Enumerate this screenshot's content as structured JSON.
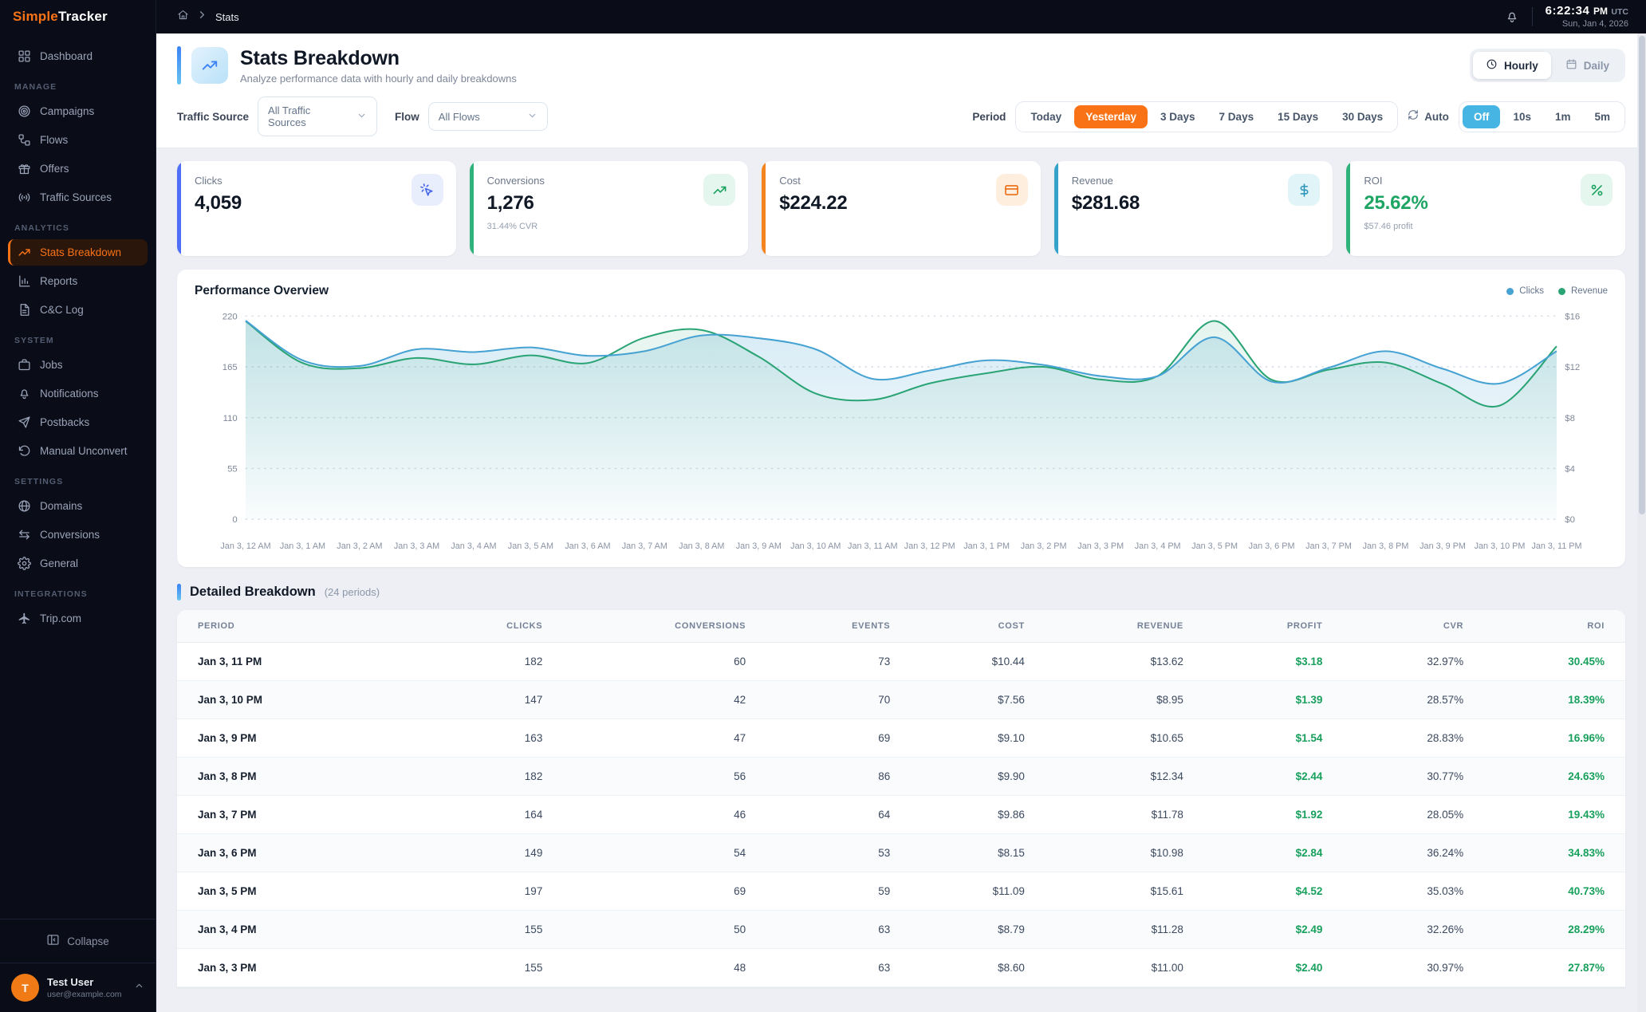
{
  "brand": {
    "name_primary": "Simple",
    "name_secondary": "Tracker"
  },
  "topbar": {
    "breadcrumb_current": "Stats",
    "clock_time": "6:22:34",
    "clock_meridiem": "PM",
    "clock_tz": "UTC",
    "clock_date": "Sun, Jan 4, 2026"
  },
  "sidebar": {
    "sections": [
      {
        "label": "",
        "items": [
          {
            "label": "Dashboard",
            "icon": "grid-icon",
            "active": false
          }
        ]
      },
      {
        "label": "MANAGE",
        "items": [
          {
            "label": "Campaigns",
            "icon": "target-icon",
            "active": false
          },
          {
            "label": "Flows",
            "icon": "flow-icon",
            "active": false
          },
          {
            "label": "Offers",
            "icon": "gift-icon",
            "active": false
          },
          {
            "label": "Traffic Sources",
            "icon": "broadcast-icon",
            "active": false
          }
        ]
      },
      {
        "label": "ANALYTICS",
        "items": [
          {
            "label": "Stats Breakdown",
            "icon": "trend-up-icon",
            "active": true
          },
          {
            "label": "Reports",
            "icon": "bar-chart-icon",
            "active": false
          },
          {
            "label": "C&C Log",
            "icon": "document-icon",
            "active": false
          }
        ]
      },
      {
        "label": "SYSTEM",
        "items": [
          {
            "label": "Jobs",
            "icon": "briefcase-icon",
            "active": false
          },
          {
            "label": "Notifications",
            "icon": "bell-icon",
            "active": false
          },
          {
            "label": "Postbacks",
            "icon": "send-icon",
            "active": false
          },
          {
            "label": "Manual Unconvert",
            "icon": "undo-icon",
            "active": false
          }
        ]
      },
      {
        "label": "SETTINGS",
        "items": [
          {
            "label": "Domains",
            "icon": "globe-icon",
            "active": false
          },
          {
            "label": "Conversions",
            "icon": "swap-icon",
            "active": false
          },
          {
            "label": "General",
            "icon": "gear-icon",
            "active": false
          }
        ]
      },
      {
        "label": "INTEGRATIONS",
        "items": [
          {
            "label": "Trip.com",
            "icon": "plane-icon",
            "active": false
          }
        ]
      }
    ],
    "collapse_label": "Collapse",
    "user": {
      "initial": "T",
      "name": "Test User",
      "email": "user@example.com"
    }
  },
  "page": {
    "title": "Stats Breakdown",
    "subtitle": "Analyze performance data with hourly and daily breakdowns",
    "view_toggle": [
      {
        "label": "Hourly",
        "icon": "clock-icon",
        "active": true
      },
      {
        "label": "Daily",
        "icon": "calendar-icon",
        "active": false
      }
    ]
  },
  "filters": {
    "traffic_source_label": "Traffic Source",
    "traffic_source_value": "All Traffic Sources",
    "flow_label": "Flow",
    "flow_value": "All Flows",
    "period_label": "Period",
    "period_options": [
      {
        "label": "Today",
        "active": false
      },
      {
        "label": "Yesterday",
        "active": true
      },
      {
        "label": "3 Days",
        "active": false
      },
      {
        "label": "7 Days",
        "active": false
      },
      {
        "label": "15 Days",
        "active": false
      },
      {
        "label": "30 Days",
        "active": false
      }
    ],
    "auto_label": "Auto",
    "refresh_options": [
      {
        "label": "Off",
        "active": true
      },
      {
        "label": "10s",
        "active": false
      },
      {
        "label": "1m",
        "active": false
      },
      {
        "label": "5m",
        "active": false
      }
    ],
    "active_period_color": "#f97316",
    "active_refresh_color": "#47b5e3"
  },
  "stat_cards": [
    {
      "label": "Clicks",
      "value": "4,059",
      "sub": "",
      "icon": "cursor-click-icon",
      "accent": "#4f6ef7",
      "icon_color": "#4263eb",
      "icon_bg": "#e9eefc",
      "value_color": ""
    },
    {
      "label": "Conversions",
      "value": "1,276",
      "sub": "31.44% CVR",
      "icon": "trend-up-icon",
      "accent": "#2fb27c",
      "icon_color": "#18a05c",
      "icon_bg": "#e4f6ee",
      "value_color": ""
    },
    {
      "label": "Cost",
      "value": "$224.22",
      "sub": "",
      "icon": "credit-card-icon",
      "accent": "#f4841f",
      "icon_color": "#ec6c13",
      "icon_bg": "#fdeedd",
      "value_color": ""
    },
    {
      "label": "Revenue",
      "value": "$281.68",
      "sub": "",
      "icon": "dollar-icon",
      "accent": "#35a3c9",
      "icon_color": "#2f96ba",
      "icon_bg": "#e1f5f9",
      "value_color": ""
    },
    {
      "label": "ROI",
      "value": "25.62%",
      "sub": "$57.46 profit",
      "icon": "percent-icon",
      "accent": "#2fb27c",
      "icon_color": "#18a05c",
      "icon_bg": "#e4f6ee",
      "value_color": "#1ea563"
    }
  ],
  "chart": {
    "title": "Performance Overview"
  },
  "chart_data": {
    "type": "line",
    "x": [
      "Jan 3, 12 AM",
      "Jan 3, 1 AM",
      "Jan 3, 2 AM",
      "Jan 3, 3 AM",
      "Jan 3, 4 AM",
      "Jan 3, 5 AM",
      "Jan 3, 6 AM",
      "Jan 3, 7 AM",
      "Jan 3, 8 AM",
      "Jan 3, 9 AM",
      "Jan 3, 10 AM",
      "Jan 3, 11 AM",
      "Jan 3, 12 PM",
      "Jan 3, 1 PM",
      "Jan 3, 2 PM",
      "Jan 3, 3 PM",
      "Jan 3, 4 PM",
      "Jan 3, 5 PM",
      "Jan 3, 6 PM",
      "Jan 3, 7 PM",
      "Jan 3, 8 PM",
      "Jan 3, 9 PM",
      "Jan 3, 10 PM",
      "Jan 3, 11 PM"
    ],
    "series": [
      {
        "name": "Clicks",
        "axis": "left",
        "color": "#46a2d2",
        "values": [
          215,
          172,
          166,
          184,
          181,
          186,
          177,
          182,
          199,
          196,
          184,
          152,
          161,
          172,
          167,
          155,
          155,
          197,
          149,
          164,
          182,
          163,
          147,
          182
        ]
      },
      {
        "name": "Revenue",
        "axis": "right",
        "color": "#2aa474",
        "values": [
          15.6,
          12.3,
          11.9,
          12.7,
          12.2,
          12.9,
          12.3,
          14.3,
          14.9,
          12.8,
          9.9,
          9.4,
          10.7,
          11.5,
          12.0,
          11.0,
          11.28,
          15.61,
          10.98,
          11.78,
          12.34,
          10.65,
          8.95,
          13.62
        ]
      }
    ],
    "left_axis": {
      "ticks": [
        220,
        165,
        110,
        55,
        0
      ],
      "max": 220
    },
    "right_axis": {
      "ticks": [
        "$16",
        "$12",
        "$8",
        "$4",
        "$0"
      ],
      "max": 16
    },
    "grid": "dotted-horizontal",
    "legend_position": "top-right"
  },
  "table": {
    "title": "Detailed Breakdown",
    "subtitle": "(24 periods)",
    "columns": [
      "PERIOD",
      "CLICKS",
      "CONVERSIONS",
      "EVENTS",
      "COST",
      "REVENUE",
      "PROFIT",
      "CVR",
      "ROI"
    ],
    "green_columns": [
      6,
      8
    ],
    "rows": [
      [
        "Jan 3, 11 PM",
        "182",
        "60",
        "73",
        "$10.44",
        "$13.62",
        "$3.18",
        "32.97%",
        "30.45%"
      ],
      [
        "Jan 3, 10 PM",
        "147",
        "42",
        "70",
        "$7.56",
        "$8.95",
        "$1.39",
        "28.57%",
        "18.39%"
      ],
      [
        "Jan 3, 9 PM",
        "163",
        "47",
        "69",
        "$9.10",
        "$10.65",
        "$1.54",
        "28.83%",
        "16.96%"
      ],
      [
        "Jan 3, 8 PM",
        "182",
        "56",
        "86",
        "$9.90",
        "$12.34",
        "$2.44",
        "30.77%",
        "24.63%"
      ],
      [
        "Jan 3, 7 PM",
        "164",
        "46",
        "64",
        "$9.86",
        "$11.78",
        "$1.92",
        "28.05%",
        "19.43%"
      ],
      [
        "Jan 3, 6 PM",
        "149",
        "54",
        "53",
        "$8.15",
        "$10.98",
        "$2.84",
        "36.24%",
        "34.83%"
      ],
      [
        "Jan 3, 5 PM",
        "197",
        "69",
        "59",
        "$11.09",
        "$15.61",
        "$4.52",
        "35.03%",
        "40.73%"
      ],
      [
        "Jan 3, 4 PM",
        "155",
        "50",
        "63",
        "$8.79",
        "$11.28",
        "$2.49",
        "32.26%",
        "28.29%"
      ],
      [
        "Jan 3, 3 PM",
        "155",
        "48",
        "63",
        "$8.60",
        "$11.00",
        "$2.40",
        "30.97%",
        "27.87%"
      ]
    ]
  }
}
